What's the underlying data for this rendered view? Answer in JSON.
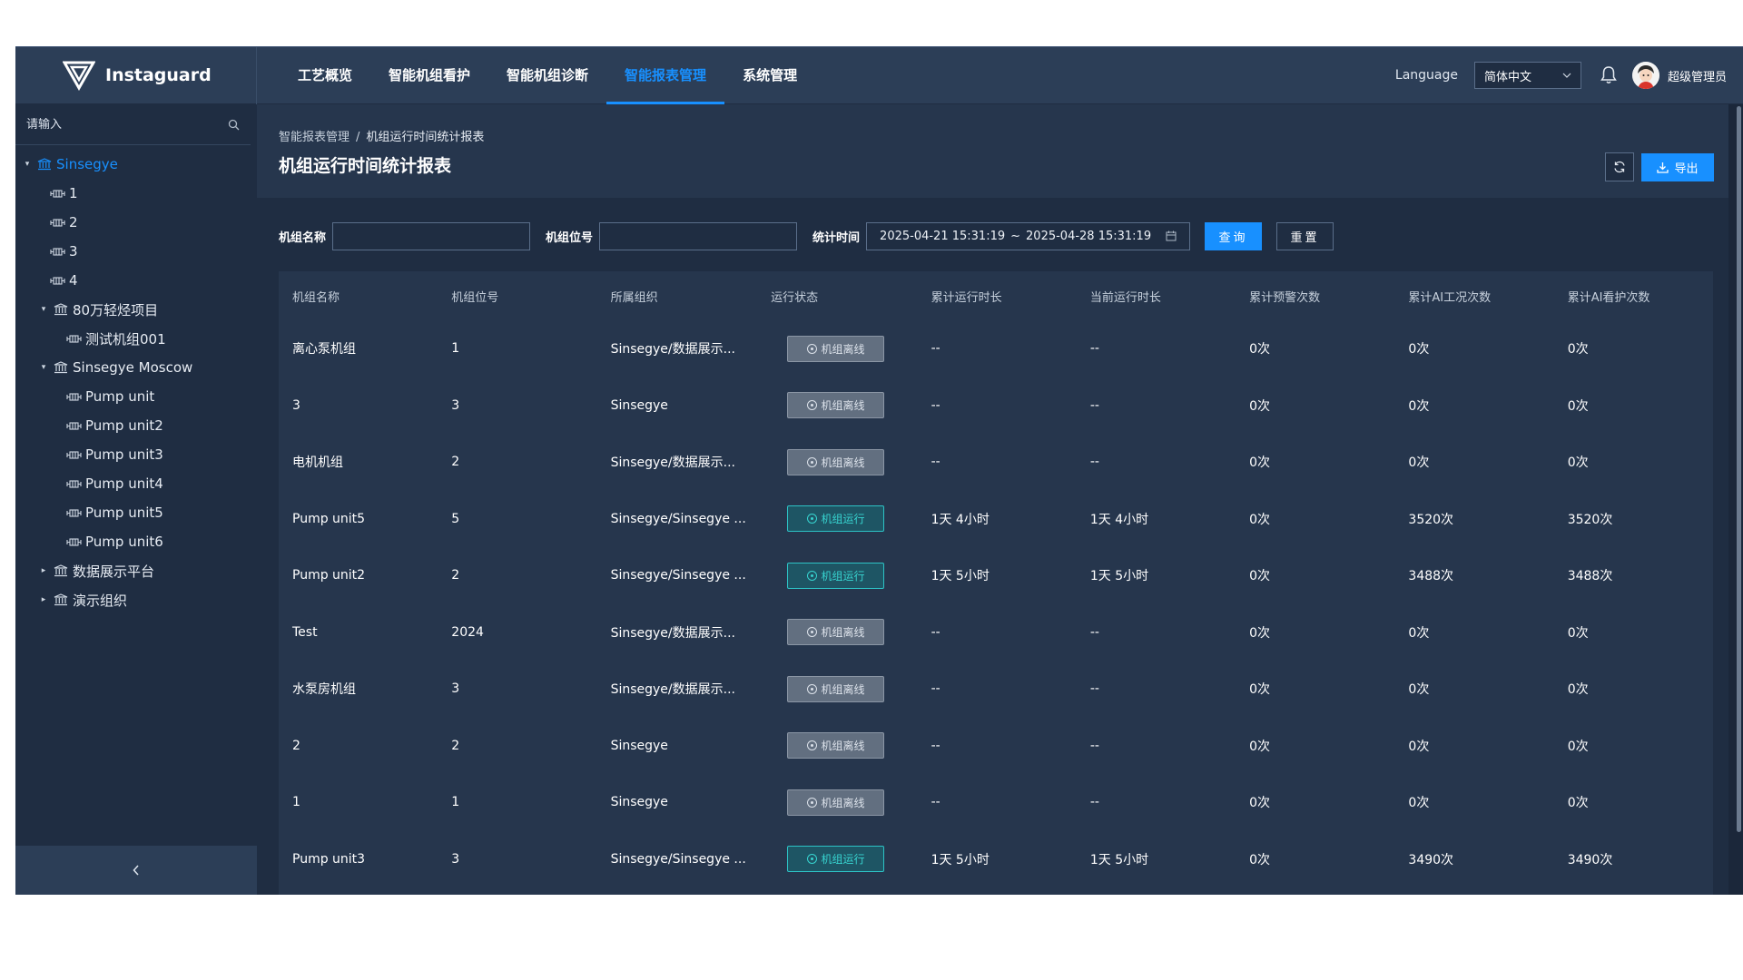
{
  "header": {
    "logo_text": "Instaguard",
    "nav": [
      "工艺概览",
      "智能机组看护",
      "智能机组诊断",
      "智能报表管理",
      "系统管理"
    ],
    "active_nav": 3,
    "language_label": "Language",
    "language_value": "简体中文",
    "user_name": "超级管理员"
  },
  "sidebar": {
    "search_placeholder": "请输入",
    "tree": [
      {
        "label": "Sinsegye",
        "type": "org",
        "level": 0,
        "expanded": true,
        "selected": true
      },
      {
        "label": "1",
        "type": "device",
        "level": 1
      },
      {
        "label": "2",
        "type": "device",
        "level": 1
      },
      {
        "label": "3",
        "type": "device",
        "level": 1
      },
      {
        "label": "4",
        "type": "device",
        "level": 1
      },
      {
        "label": "80万轻烃项目",
        "type": "org",
        "level": 1,
        "expanded": true
      },
      {
        "label": "测试机组001",
        "type": "device",
        "level": 2
      },
      {
        "label": "Sinsegye Moscow",
        "type": "org",
        "level": 1,
        "expanded": true
      },
      {
        "label": "Pump unit",
        "type": "device",
        "level": 2
      },
      {
        "label": "Pump unit2",
        "type": "device",
        "level": 2
      },
      {
        "label": "Pump unit3",
        "type": "device",
        "level": 2
      },
      {
        "label": "Pump unit4",
        "type": "device",
        "level": 2
      },
      {
        "label": "Pump unit5",
        "type": "device",
        "level": 2
      },
      {
        "label": "Pump unit6",
        "type": "device",
        "level": 2
      },
      {
        "label": "数据展示平台",
        "type": "org",
        "level": 1,
        "expanded": false
      },
      {
        "label": "演示组织",
        "type": "org",
        "level": 1,
        "expanded": false
      }
    ],
    "collapse_icon": "chevron-left-icon"
  },
  "page": {
    "breadcrumb": [
      "智能报表管理",
      "机组运行时间统计报表"
    ],
    "breadcrumb_sep": "/",
    "title": "机组运行时间统计报表",
    "export_label": "导出"
  },
  "filters": {
    "unit_name_label": "机组名称",
    "unit_name_value": "",
    "unit_tag_label": "机组位号",
    "unit_tag_value": "",
    "time_label": "统计时间",
    "start": "2025-04-21 15:31:19",
    "end": "2025-04-28 15:31:19",
    "range_sep": "~",
    "query_label": "查询",
    "reset_label": "重置"
  },
  "table": {
    "columns": [
      "机组名称",
      "机组位号",
      "所属组织",
      "运行状态",
      "累计运行时长",
      "当前运行时长",
      "累计预警次数",
      "累计AI工况次数",
      "累计AI看护次数"
    ],
    "rows": [
      {
        "name": "离心泵机组",
        "tag": "1",
        "org": "Sinsegye/数据展示...",
        "status": "机组离线",
        "running": false,
        "total": "--",
        "current": "--",
        "alerts": "0次",
        "ai_cond": "0次",
        "ai_care": "0次"
      },
      {
        "name": "3",
        "tag": "3",
        "org": "Sinsegye",
        "status": "机组离线",
        "running": false,
        "total": "--",
        "current": "--",
        "alerts": "0次",
        "ai_cond": "0次",
        "ai_care": "0次"
      },
      {
        "name": "电机机组",
        "tag": "2",
        "org": "Sinsegye/数据展示...",
        "status": "机组离线",
        "running": false,
        "total": "--",
        "current": "--",
        "alerts": "0次",
        "ai_cond": "0次",
        "ai_care": "0次"
      },
      {
        "name": "Pump unit5",
        "tag": "5",
        "org": "Sinsegye/Sinsegye ...",
        "status": "机组运行",
        "running": true,
        "total": "1天 4小时",
        "current": "1天 4小时",
        "alerts": "0次",
        "ai_cond": "3520次",
        "ai_care": "3520次"
      },
      {
        "name": "Pump unit2",
        "tag": "2",
        "org": "Sinsegye/Sinsegye ...",
        "status": "机组运行",
        "running": true,
        "total": "1天 5小时",
        "current": "1天 5小时",
        "alerts": "0次",
        "ai_cond": "3488次",
        "ai_care": "3488次"
      },
      {
        "name": "Test",
        "tag": "2024",
        "org": "Sinsegye/数据展示...",
        "status": "机组离线",
        "running": false,
        "total": "--",
        "current": "--",
        "alerts": "0次",
        "ai_cond": "0次",
        "ai_care": "0次"
      },
      {
        "name": "水泵房机组",
        "tag": "3",
        "org": "Sinsegye/数据展示...",
        "status": "机组离线",
        "running": false,
        "total": "--",
        "current": "--",
        "alerts": "0次",
        "ai_cond": "0次",
        "ai_care": "0次"
      },
      {
        "name": "2",
        "tag": "2",
        "org": "Sinsegye",
        "status": "机组离线",
        "running": false,
        "total": "--",
        "current": "--",
        "alerts": "0次",
        "ai_cond": "0次",
        "ai_care": "0次"
      },
      {
        "name": "1",
        "tag": "1",
        "org": "Sinsegye",
        "status": "机组离线",
        "running": false,
        "total": "--",
        "current": "--",
        "alerts": "0次",
        "ai_cond": "0次",
        "ai_care": "0次"
      },
      {
        "name": "Pump unit3",
        "tag": "3",
        "org": "Sinsegye/Sinsegye ...",
        "status": "机组运行",
        "running": true,
        "total": "1天 5小时",
        "current": "1天 5小时",
        "alerts": "0次",
        "ai_cond": "3490次",
        "ai_care": "3490次"
      }
    ]
  },
  "colors": {
    "accent": "#1890ff",
    "running": "#37d4d0",
    "offline": "#626f80",
    "header_bg": "#2c3e57",
    "page_bg": "#1f2d42"
  }
}
